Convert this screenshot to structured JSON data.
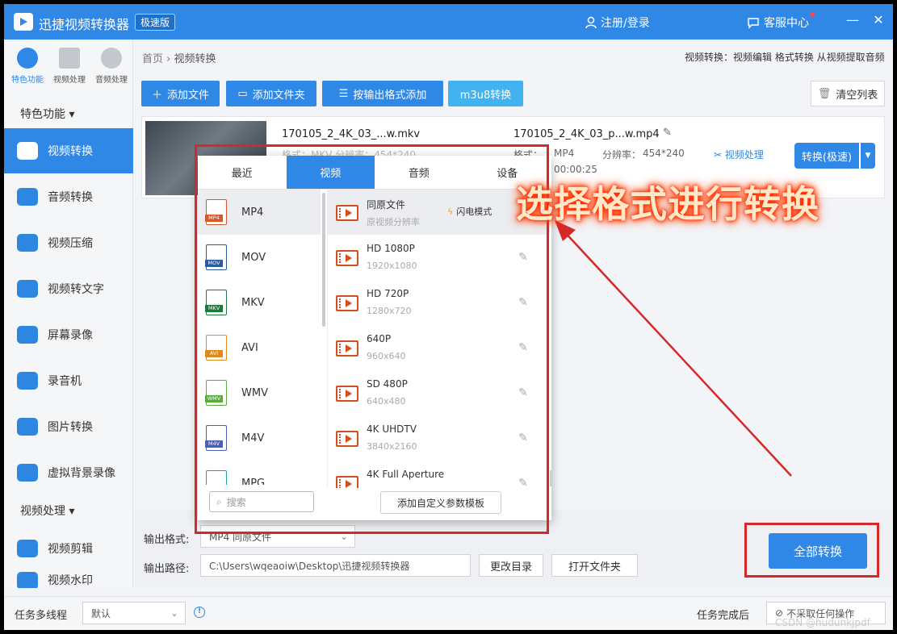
{
  "titlebar": {
    "app_title": "迅捷视频转换器",
    "badge": "极速版",
    "login": "注册/登录",
    "service": "客服中心",
    "minimize": "—",
    "close": "✕"
  },
  "sidebar": {
    "top_icons": [
      {
        "label": "特色功能"
      },
      {
        "label": "视频处理"
      },
      {
        "label": "音频处理"
      }
    ],
    "section1": "特色功能 ▾",
    "section2": "视频处理 ▾",
    "items": [
      {
        "label": "视频转换"
      },
      {
        "label": "音频转换"
      },
      {
        "label": "视频压缩"
      },
      {
        "label": "视频转文字"
      },
      {
        "label": "屏幕录像"
      },
      {
        "label": "录音机"
      },
      {
        "label": "图片转换"
      },
      {
        "label": "虚拟背景录像"
      },
      {
        "label": "视频剪辑"
      },
      {
        "label": "视频水印"
      }
    ]
  },
  "breadcrumb": {
    "home": "首页",
    "sep": "›",
    "current": "视频转换"
  },
  "breadcrumb_right": "视频转换：视频编辑 格式转换 从视频提取音频",
  "toolbar": {
    "add_file": "添加文件",
    "add_folder": "添加文件夹",
    "add_by_format": "按输出格式添加",
    "m3u8": "m3u8转换",
    "clear": "清空列表"
  },
  "file": {
    "input_name": "170105_2_4K_03_...w.mkv",
    "input_meta": "格式：MKV   分辨率：454*240",
    "output_name": "170105_2_4K_03_p...w.mp4",
    "output_format_label": "格式：",
    "output_format": "MP4",
    "output_res_label": "分辨率：",
    "output_res": "454*240",
    "output_duration": "00:00:25",
    "process": "视频处理",
    "convert": "转换(极速)"
  },
  "popup": {
    "tabs": [
      "最近",
      "视频",
      "音频",
      "设备"
    ],
    "formats": [
      {
        "name": "MP4",
        "color": "#d35a2a"
      },
      {
        "name": "MOV",
        "color": "#2c5aa0"
      },
      {
        "name": "MKV",
        "color": "#1e7a3c"
      },
      {
        "name": "AVI",
        "color": "#e08a1e"
      },
      {
        "name": "WMV",
        "color": "#5aab3d"
      },
      {
        "name": "M4V",
        "color": "#4a5fb5"
      },
      {
        "name": "MPG",
        "color": "#1fa39a"
      }
    ],
    "presets": [
      {
        "name": "同原文件",
        "res": "原视频分辨率"
      },
      {
        "name": "HD 1080P",
        "res": "1920x1080"
      },
      {
        "name": "HD 720P",
        "res": "1280x720"
      },
      {
        "name": "640P",
        "res": "960x640"
      },
      {
        "name": "SD 480P",
        "res": "640x480"
      },
      {
        "name": "4K UHDTV",
        "res": "3840x2160"
      },
      {
        "name": "4K Full Aperture",
        "res": ""
      }
    ],
    "flash_mode": "闪电模式",
    "search_placeholder": "搜索",
    "add_template": "添加自定义参数模板"
  },
  "output": {
    "format_label": "输出格式:",
    "format_value": "MP4  同原文件",
    "path_label": "输出路径:",
    "path_value": "C:\\Users\\wqeaoiw\\Desktop\\迅捷视频转换器",
    "change_dir": "更改目录",
    "open_folder": "打开文件夹",
    "convert_all": "全部转换"
  },
  "status": {
    "multithread_label": "任务多线程",
    "multithread_value": "默认",
    "after_label": "任务完成后",
    "after_value": "不采取任何操作"
  },
  "annotation": {
    "callout": "选择格式进行转换",
    "color": "#d62828"
  },
  "watermark": "CSDN @hudunkjpdf"
}
